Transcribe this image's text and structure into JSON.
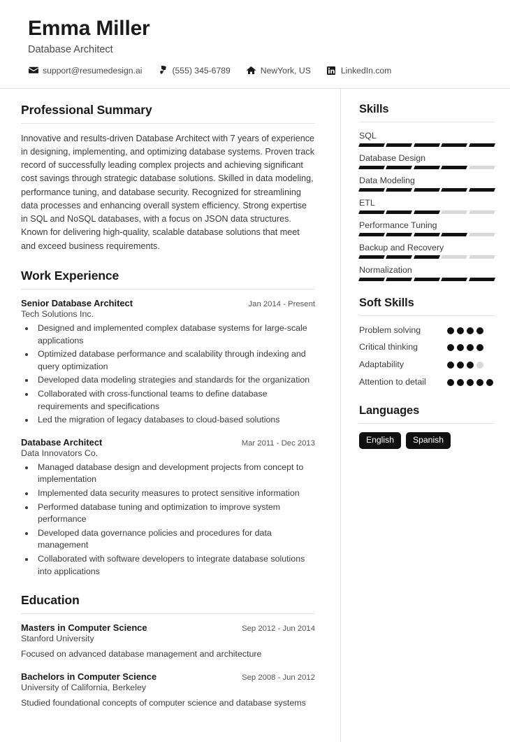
{
  "header": {
    "name": "Emma Miller",
    "job_title": "Database Architect",
    "contacts": [
      {
        "icon": "envelope-icon",
        "text": "support@resumedesign.ai"
      },
      {
        "icon": "phone-icon",
        "text": "(555) 345-6789"
      },
      {
        "icon": "home-icon",
        "text": "NewYork, US"
      },
      {
        "icon": "linkedin-icon",
        "text": "LinkedIn.com"
      }
    ]
  },
  "main": {
    "summary_section": {
      "title": "Professional Summary",
      "text": "Innovative and results-driven Database Architect with 7 years of experience in designing, implementing, and optimizing database systems. Proven track record of successfully leading complex projects and achieving significant cost savings through strategic database solutions. Skilled in data modeling, performance tuning, and database security. Recognized for streamlining data processes and enhancing overall system efficiency. Strong expertise in SQL and NoSQL databases, with a focus on JSON data structures. Known for delivering high-quality, scalable database solutions that meet and exceed business requirements."
    },
    "experience_section": {
      "title": "Work Experience",
      "entries": [
        {
          "role": "Senior Database Architect",
          "date": "Jan 2014 - Present",
          "org": "Tech Solutions Inc.",
          "bullets": [
            "Designed and implemented complex database systems for large-scale applications",
            "Optimized database performance and scalability through indexing and query optimization",
            "Developed data modeling strategies and standards for the organization",
            "Collaborated with cross-functional teams to define database requirements and specifications",
            "Led the migration of legacy databases to cloud-based solutions"
          ]
        },
        {
          "role": "Database Architect",
          "date": "Mar 2011 - Dec 2013",
          "org": "Data Innovators Co.",
          "bullets": [
            "Managed database design and development projects from concept to implementation",
            "Implemented data security measures to protect sensitive information",
            "Performed database tuning and optimization to improve system performance",
            "Developed data governance policies and procedures for data management",
            "Collaborated with software developers to integrate database solutions into applications"
          ]
        }
      ]
    },
    "education_section": {
      "title": "Education",
      "entries": [
        {
          "degree": "Masters in Computer Science",
          "date": "Sep 2012 - Jun 2014",
          "school": "Stanford University",
          "description": "Focused on advanced database management and architecture"
        },
        {
          "degree": "Bachelors in Computer Science",
          "date": "Sep 2008 - Jun 2012",
          "school": "University of California, Berkeley",
          "description": "Studied foundational concepts of computer science and database systems"
        }
      ]
    }
  },
  "sidebar": {
    "skills_section": {
      "title": "Skills",
      "max_level": 5,
      "items": [
        {
          "name": "SQL",
          "level": 5
        },
        {
          "name": "Database Design",
          "level": 4
        },
        {
          "name": "Data Modeling",
          "level": 5
        },
        {
          "name": "ETL",
          "level": 3
        },
        {
          "name": "Performance Tuning",
          "level": 4
        },
        {
          "name": "Backup and Recovery",
          "level": 3
        },
        {
          "name": "Normalization",
          "level": 5
        }
      ]
    },
    "soft_skills_section": {
      "title": "Soft Skills",
      "items": [
        {
          "name": "Problem solving",
          "level": 4,
          "max": 4
        },
        {
          "name": "Critical thinking",
          "level": 4,
          "max": 4
        },
        {
          "name": "Adaptability",
          "level": 3,
          "max": 4
        },
        {
          "name": "Attention to detail",
          "level": 5,
          "max": 5
        }
      ]
    },
    "languages_section": {
      "title": "Languages",
      "items": [
        "English",
        "Spanish"
      ]
    }
  },
  "colors": {
    "accent": "#111111",
    "inactive": "#d8d8d8",
    "text": "#3a3a3a",
    "rule": "#e4e4e4"
  }
}
